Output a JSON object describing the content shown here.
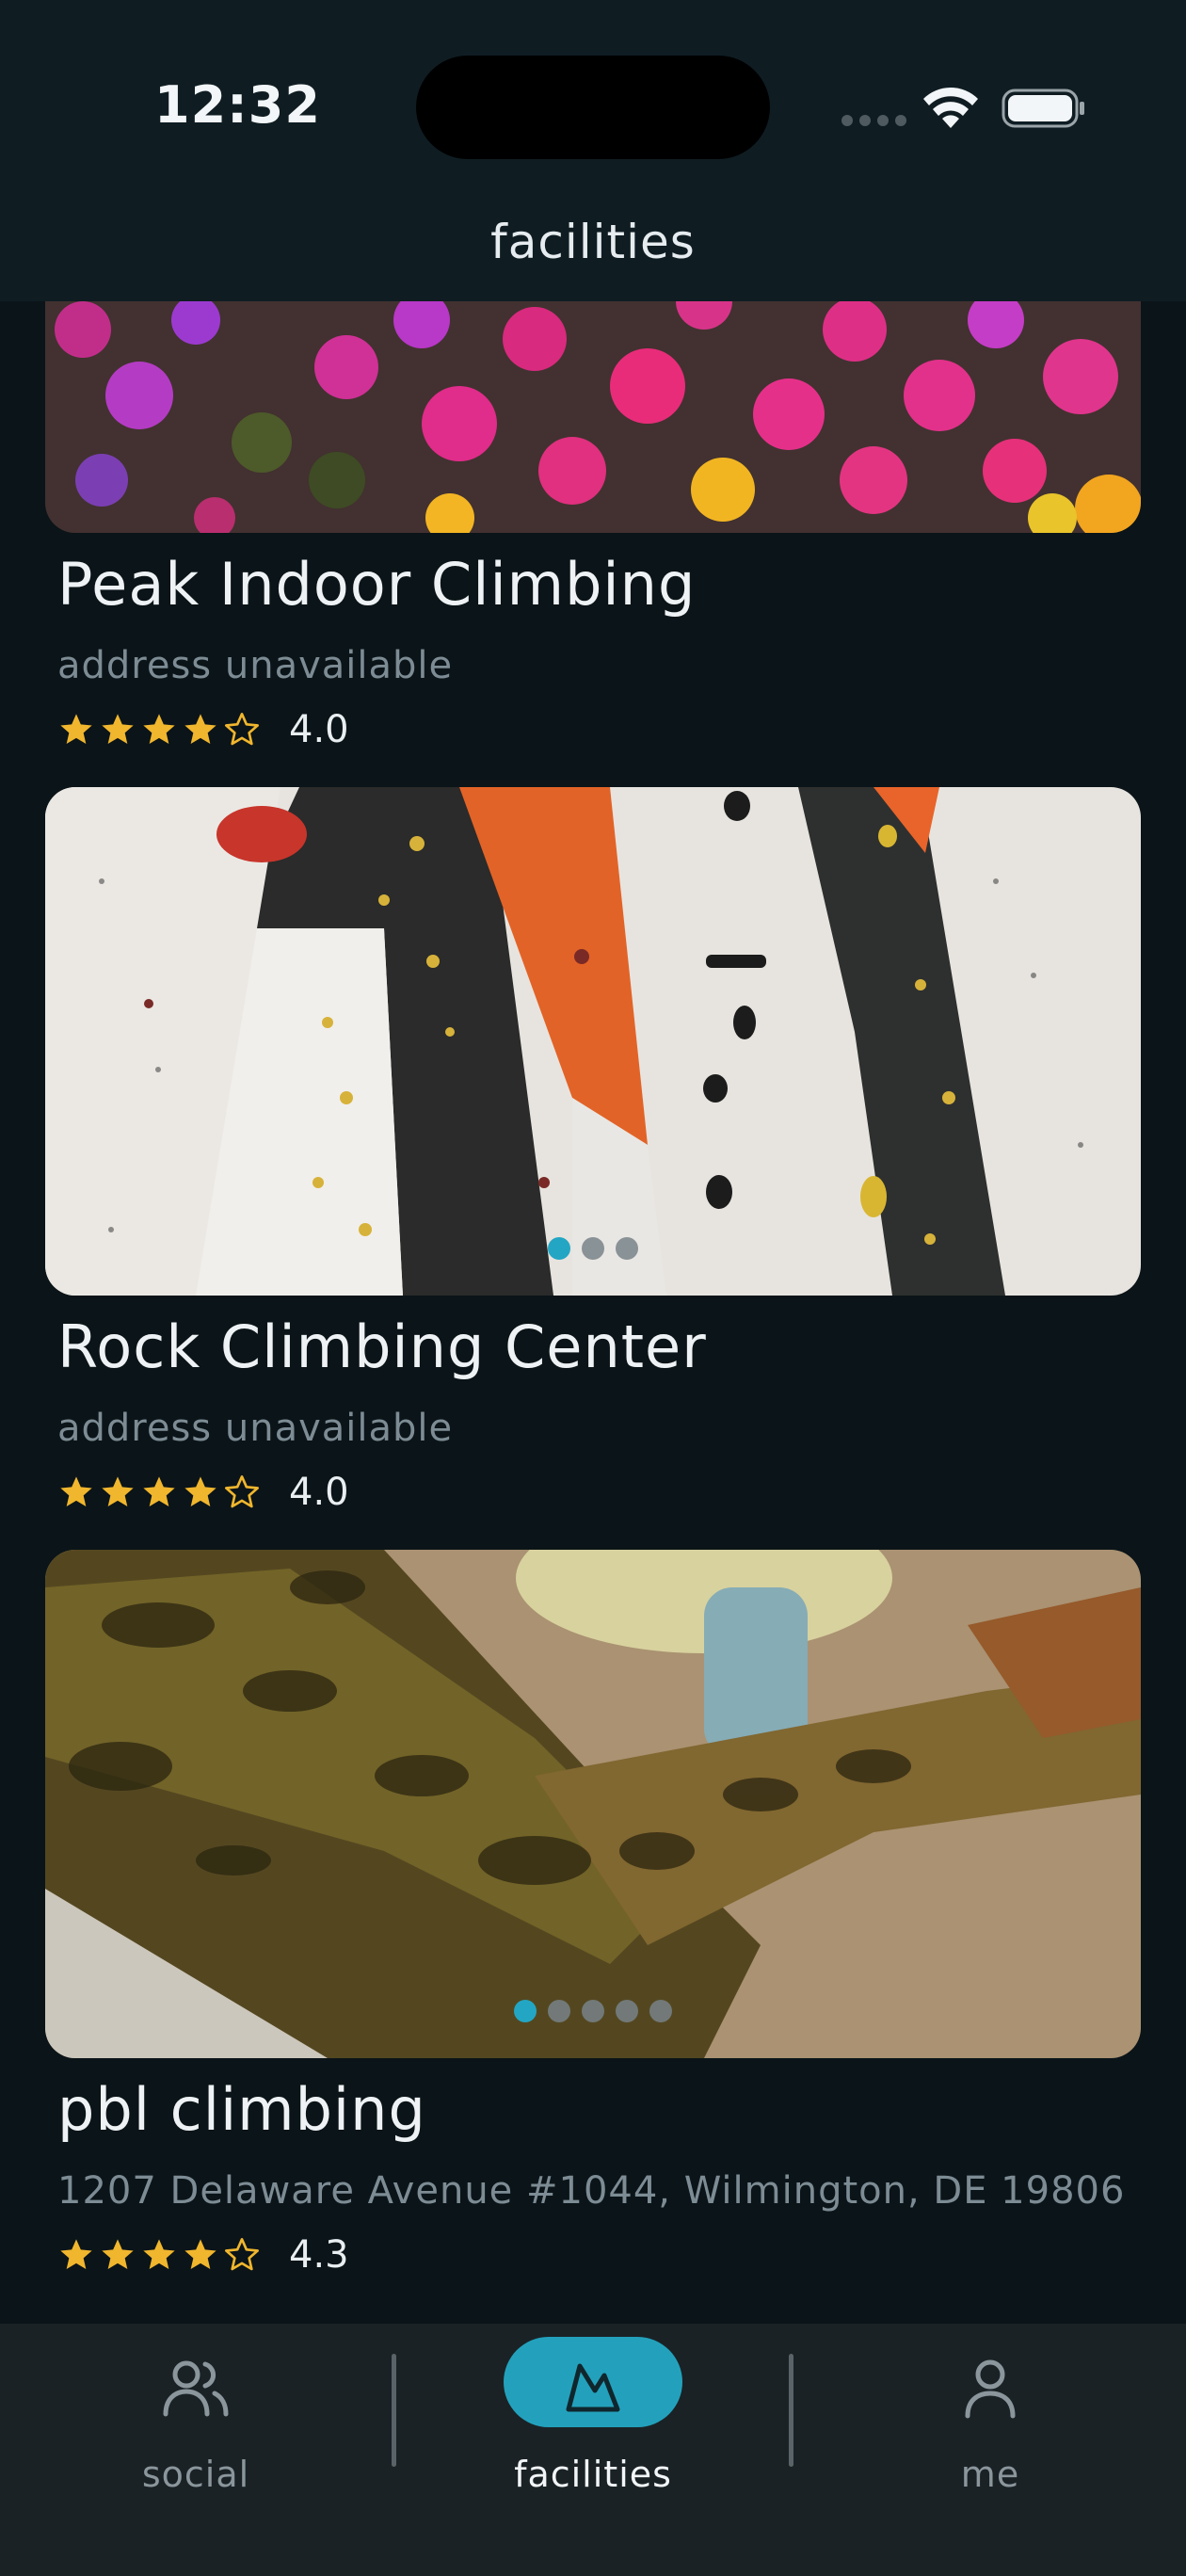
{
  "status_bar": {
    "time": "12:32"
  },
  "header": {
    "title": "facilities"
  },
  "facilities": [
    {
      "name": "Peak Indoor Climbing",
      "address": "address unavailable",
      "rating": 4.0,
      "rating_label": "4.0",
      "image_subject": "pink and magenta flowers with yellow blooms",
      "photo_count": 1,
      "active_photo": 0
    },
    {
      "name": "Rock Climbing Center",
      "address": "address unavailable",
      "rating": 4.0,
      "rating_label": "4.0",
      "image_subject": "indoor climbing wall with orange and dark panels and holds",
      "photo_count": 3,
      "active_photo": 0
    },
    {
      "name": "pbl climbing",
      "address": "1207 Delaware Avenue #1044, Wilmington, DE 19806",
      "rating": 4.3,
      "rating_label": "4.3",
      "image_subject": "close-up of a lizard on a rock",
      "photo_count": 5,
      "active_photo": 0
    }
  ],
  "tabbar": {
    "tabs": [
      {
        "label": "social",
        "icon": "people-icon",
        "active": false
      },
      {
        "label": "facilities",
        "icon": "mountain-icon",
        "active": true
      },
      {
        "label": "me",
        "icon": "person-icon",
        "active": false
      }
    ]
  },
  "colors": {
    "accent": "#23a1bc",
    "star": "#f0b62e",
    "background": "#0b1418",
    "tabbar": "#1a2226"
  }
}
